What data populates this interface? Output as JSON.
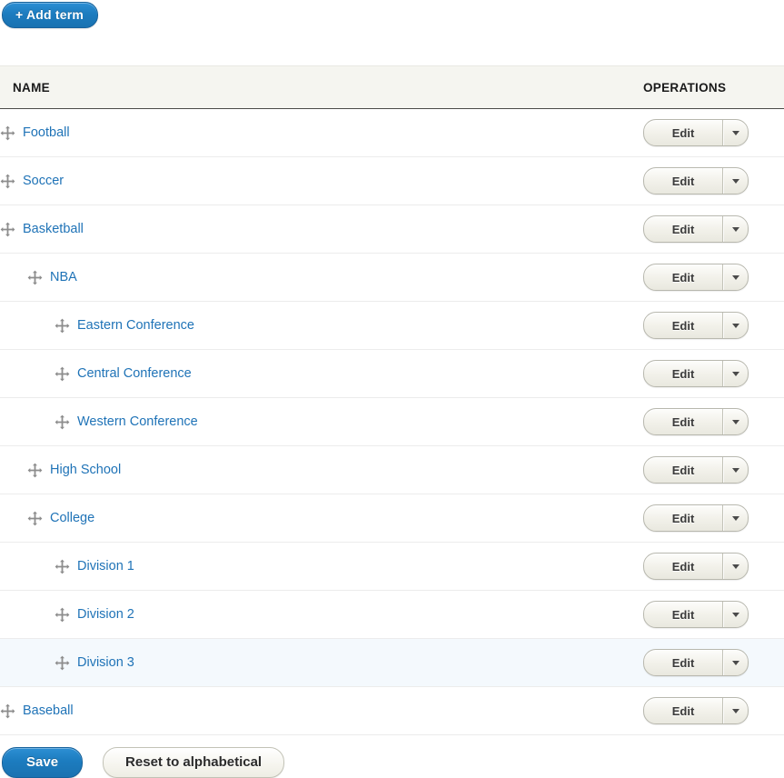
{
  "toolbar": {
    "add_term_label": "+ Add term"
  },
  "table": {
    "columns": {
      "name": "NAME",
      "operations": "OPERATIONS"
    },
    "rows": [
      {
        "name": "Football",
        "depth": 0,
        "edit_label": "Edit",
        "highlighted": false
      },
      {
        "name": "Soccer",
        "depth": 0,
        "edit_label": "Edit",
        "highlighted": false
      },
      {
        "name": "Basketball",
        "depth": 0,
        "edit_label": "Edit",
        "highlighted": false
      },
      {
        "name": "NBA",
        "depth": 1,
        "edit_label": "Edit",
        "highlighted": false
      },
      {
        "name": "Eastern Conference",
        "depth": 2,
        "edit_label": "Edit",
        "highlighted": false
      },
      {
        "name": "Central Conference",
        "depth": 2,
        "edit_label": "Edit",
        "highlighted": false
      },
      {
        "name": "Western Conference",
        "depth": 2,
        "edit_label": "Edit",
        "highlighted": false
      },
      {
        "name": "High School",
        "depth": 1,
        "edit_label": "Edit",
        "highlighted": false
      },
      {
        "name": "College",
        "depth": 1,
        "edit_label": "Edit",
        "highlighted": false
      },
      {
        "name": "Division 1",
        "depth": 2,
        "edit_label": "Edit",
        "highlighted": false
      },
      {
        "name": "Division 2",
        "depth": 2,
        "edit_label": "Edit",
        "highlighted": false
      },
      {
        "name": "Division 3",
        "depth": 2,
        "edit_label": "Edit",
        "highlighted": true
      },
      {
        "name": "Baseball",
        "depth": 0,
        "edit_label": "Edit",
        "highlighted": false
      }
    ]
  },
  "actions": {
    "save_label": "Save",
    "reset_label": "Reset to alphabetical"
  },
  "icons": {
    "drag_handle": "move-cross-icon",
    "dropdown_caret": "chevron-down-icon"
  },
  "colors": {
    "accent_blue": "#1c7cbf",
    "link_blue": "#1f73b7",
    "header_bg": "#f5f5f0",
    "row_highlight": "#f4f9fd",
    "button_face": "#f2f1ea"
  }
}
